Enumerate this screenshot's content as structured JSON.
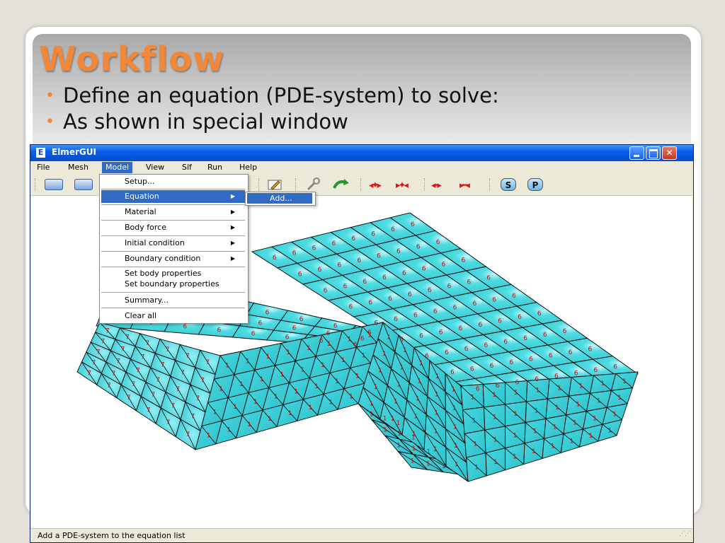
{
  "slide": {
    "title": "Workflow",
    "bullets": [
      "Define an equation (PDE-system) to solve:",
      "As shown in special window"
    ]
  },
  "window": {
    "title": "ElmerGUI",
    "app_icon": "E",
    "controls": [
      "minimize-icon",
      "maximize-icon",
      "close-icon"
    ]
  },
  "menubar": {
    "items": [
      {
        "label": "File"
      },
      {
        "label": "Mesh"
      },
      {
        "label": "Model",
        "active": true
      },
      {
        "label": "View"
      },
      {
        "label": "Sif"
      },
      {
        "label": "Run"
      },
      {
        "label": "Help"
      }
    ]
  },
  "model_menu": {
    "items": [
      {
        "label": "Setup..."
      },
      {
        "label": "Equation",
        "has_submenu": true,
        "highlighted": true
      },
      {
        "label": "Material",
        "has_submenu": true
      },
      {
        "label": "Body force",
        "has_submenu": true
      },
      {
        "label": "Initial condition",
        "has_submenu": true
      },
      {
        "label": "Boundary condition",
        "has_submenu": true
      },
      {
        "label": "Set body properties"
      },
      {
        "label": "Set boundary properties"
      },
      {
        "label": "Summary..."
      },
      {
        "label": "Clear all"
      }
    ]
  },
  "equation_submenu": {
    "items": [
      {
        "label": "Add..."
      }
    ]
  },
  "toolbar": {
    "icons": [
      "open-icon",
      "save-icon",
      "pencil-icon",
      "wrench-icon",
      "redo-arrow-icon",
      "expand-horizontal-icon",
      "contract-horizontal-icon",
      "unify-icon",
      "divide-icon",
      "sif-icon",
      "post-icon"
    ],
    "s_label": "S",
    "p_label": "P"
  },
  "mesh": {
    "body_labels": [
      "7",
      "6",
      "1"
    ],
    "colors": {
      "face": "#3fd4dc",
      "highlight": "#b8f6fb",
      "edge": "#000000",
      "label": "#c01010"
    }
  },
  "status": {
    "text": "Add a PDE-system to the equation list"
  }
}
